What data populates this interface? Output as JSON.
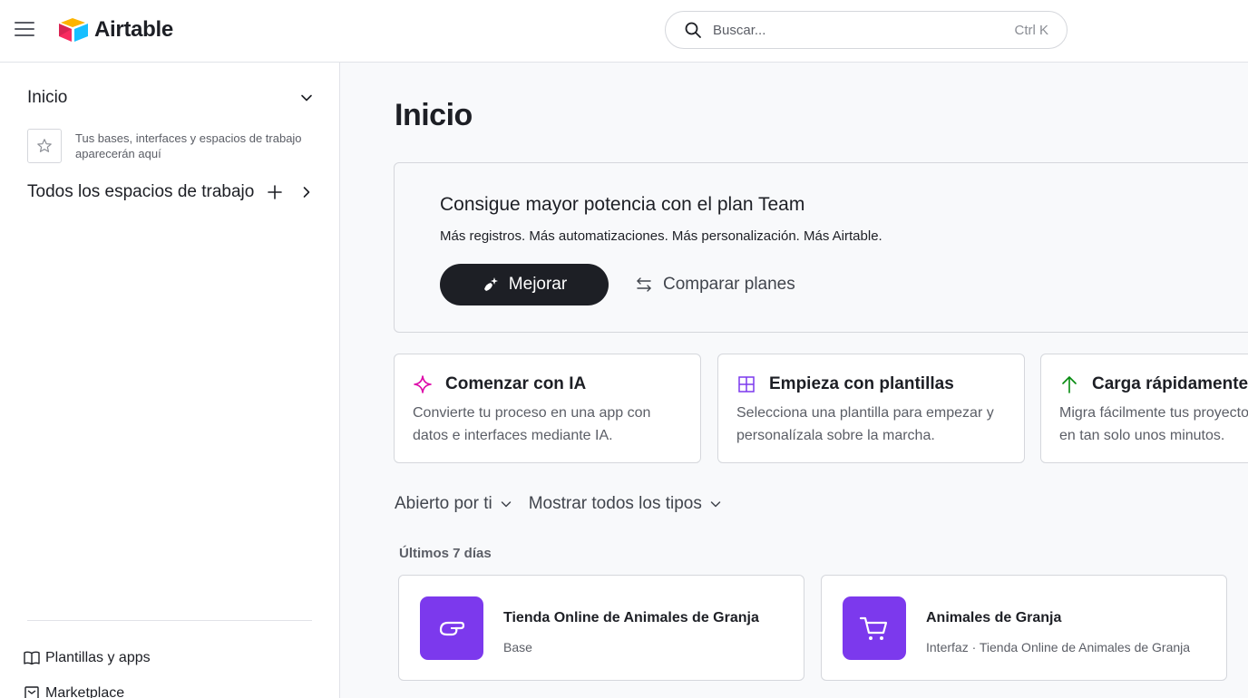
{
  "app": {
    "name": "Airtable"
  },
  "search": {
    "placeholder": "Buscar...",
    "shortcut": "Ctrl K"
  },
  "sidebar": {
    "home_label": "Inicio",
    "empty_text": "Tus bases, interfaces y espacios de trabajo aparecerán aquí",
    "workspaces_label": "Todos los espacios de trabajo",
    "links": [
      {
        "label": "Plantillas y apps",
        "icon": "book-icon"
      },
      {
        "label": "Marketplace",
        "icon": "store-icon"
      }
    ]
  },
  "main": {
    "title": "Inicio",
    "upsell": {
      "title": "Consigue mayor potencia con el plan Team",
      "subtitle": "Más registros. Más automatizaciones. Más personalización. Más Airtable.",
      "upgrade_label": "Mejorar",
      "compare_label": "Comparar planes"
    },
    "cards": [
      {
        "title": "Comenzar con IA",
        "desc": "Convierte tu proceso en una app con datos e interfaces mediante IA.",
        "icon": "sparkle-icon",
        "color": "#dd04a8"
      },
      {
        "title": "Empieza con plantillas",
        "desc": "Selecciona una plantilla para empezar y personalízala sobre la marcha.",
        "icon": "grid-icon",
        "color": "#7c39ed"
      },
      {
        "title": "Carga rápidamente",
        "desc": "Migra fácilmente tus proyectos existentes en tan solo unos minutos.",
        "icon": "arrow-up-icon",
        "color": "#048a0e"
      }
    ],
    "filters": {
      "opened_by": "Abierto por ti",
      "types": "Mostrar todos los tipos"
    },
    "section_label": "Últimos 7 días",
    "items": [
      {
        "title": "Tienda Online de Animales de Granja",
        "subtitle": "Base",
        "icon": "hand-point-icon",
        "color": "#7c39ed"
      },
      {
        "title": "Animales de Granja",
        "subtitle": "Interfaz · Tienda Online de Animales de Granja",
        "icon": "cart-icon",
        "color": "#7c39ed"
      }
    ]
  },
  "colors": {
    "dark_button": "#1d1f25",
    "purple": "#7c39ed",
    "pink": "#dd04a8",
    "green": "#048a0e"
  }
}
